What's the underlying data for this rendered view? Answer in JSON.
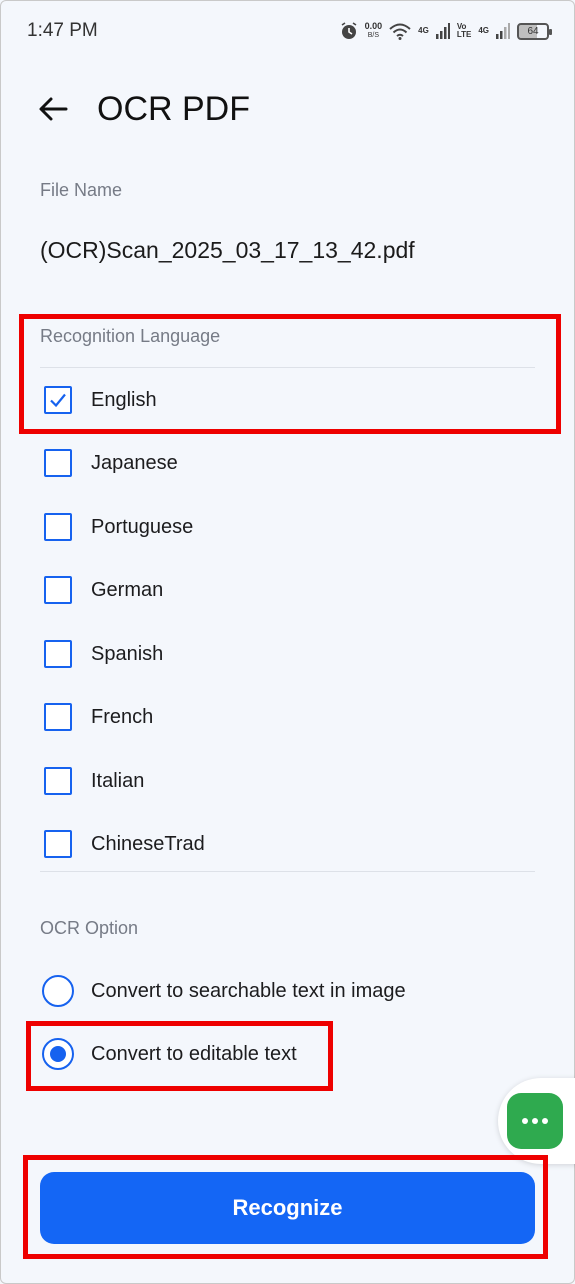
{
  "status_bar": {
    "time": "1:47 PM",
    "net_speed_value": "0.00",
    "net_speed_unit": "B/S",
    "network_1": "4G",
    "volte_top": "Vo",
    "volte_bottom": "LTE",
    "network_2": "4G",
    "battery": "64"
  },
  "header": {
    "title": "OCR PDF",
    "back_icon": "arrow-left-icon"
  },
  "file": {
    "label": "File Name",
    "value": "(OCR)Scan_2025_03_17_13_42.pdf"
  },
  "recognition": {
    "label": "Recognition Language",
    "languages": [
      {
        "label": "English",
        "checked": true
      },
      {
        "label": "Japanese",
        "checked": false
      },
      {
        "label": "Portuguese",
        "checked": false
      },
      {
        "label": "German",
        "checked": false
      },
      {
        "label": "Spanish",
        "checked": false
      },
      {
        "label": "French",
        "checked": false
      },
      {
        "label": "Italian",
        "checked": false
      },
      {
        "label": "ChineseTrad",
        "checked": false
      }
    ]
  },
  "ocr_option": {
    "label": "OCR Option",
    "options": [
      {
        "label": "Convert to searchable text in image",
        "selected": false
      },
      {
        "label": "Convert to editable text",
        "selected": true
      }
    ]
  },
  "actions": {
    "recognize_label": "Recognize",
    "chat_icon": "more-dots-icon"
  },
  "colors": {
    "accent": "#1662ef",
    "button": "#1466f5",
    "highlight": "#ee0000",
    "fab": "#2faa4f",
    "background": "#f4f7fc"
  }
}
